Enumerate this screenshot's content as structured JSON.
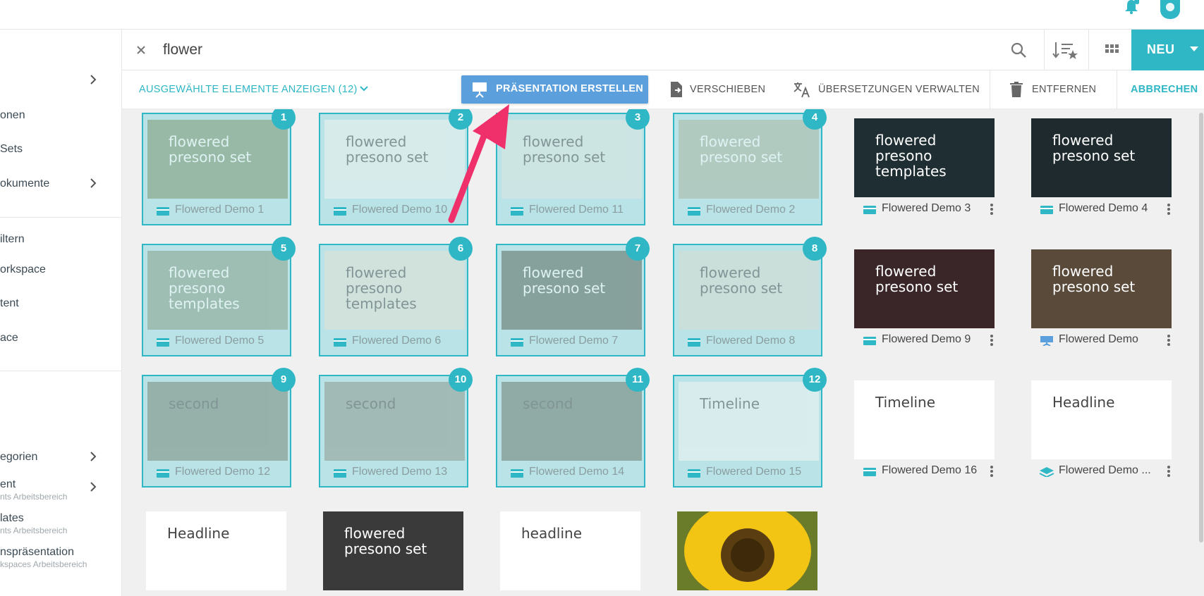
{
  "topbar": {
    "notification_icon": "bell-icon",
    "user_icon": "user-avatar-icon"
  },
  "sidebar": {
    "items": [
      {
        "label": "",
        "has_chevron": true
      },
      {
        "label": "onen"
      },
      {
        "label": "Sets"
      },
      {
        "label": "okumente",
        "has_chevron": true
      },
      {
        "label": "iltern"
      },
      {
        "label": "orkspace"
      },
      {
        "label": "tent"
      },
      {
        "label": "ace"
      },
      {
        "label": "egorien",
        "has_chevron": true
      },
      {
        "label": "ent",
        "sub": "nts Arbeitsbereich",
        "has_chevron": true
      },
      {
        "label": "lates",
        "sub": "nts Arbeitsbereich"
      },
      {
        "label": "nspräsentation",
        "sub": "kspaces Arbeitsbereich"
      }
    ]
  },
  "search": {
    "value": "flower",
    "clear_icon": "close-icon",
    "search_icon": "search-icon",
    "sort_icon": "sort-favorites-icon",
    "grid_icon": "grid-view-icon"
  },
  "new_button": {
    "label": "NEU"
  },
  "actions": {
    "show_selected": "AUSGEWÄHLTE ELEMENTE ANZEIGEN (12)",
    "create_presentation": "PRÄSENTATION ERSTELLEN",
    "move": "VERSCHIEBEN",
    "translations": "ÜBERSETZUNGEN VERWALTEN",
    "remove": "ENTFERNEN",
    "cancel": "ABBRECHEN"
  },
  "colors": {
    "accent": "#2fb7c6",
    "create_button": "#5ba0dd",
    "arrow": "#f0306a",
    "selected_bg": "#b9e3e6"
  },
  "cards": [
    {
      "name": "Flowered Demo 1",
      "badge": "1",
      "selected": true,
      "thumb_text": "flowered presono set",
      "bg": "#7d9770",
      "text_color": "#ffffff",
      "type": "presentation"
    },
    {
      "name": "Flowered Demo 10",
      "badge": "2",
      "selected": true,
      "thumb_text": "flowered presono set",
      "bg": "#eef2ee",
      "text_color": "#555555",
      "type": "presentation"
    },
    {
      "name": "Flowered Demo 11",
      "badge": "3",
      "selected": true,
      "thumb_text": "flowered presono set",
      "bg": "#dde7e2",
      "text_color": "#555555",
      "type": "presentation"
    },
    {
      "name": "Flowered Demo 2",
      "badge": "4",
      "selected": true,
      "thumb_text": "flowered presono set",
      "bg": "#aab7a2",
      "text_color": "#ffffff",
      "type": "presentation"
    },
    {
      "name": "Flowered Demo 3",
      "badge": "",
      "selected": false,
      "thumb_text": "flowered presono templates",
      "bg": "#1e2e33",
      "text_color": "#ffffff",
      "type": "presentation"
    },
    {
      "name": "Flowered Demo 4",
      "badge": "",
      "selected": false,
      "thumb_text": "flowered presono set",
      "bg": "#1f2a2e",
      "text_color": "#ffffff",
      "type": "presentation"
    },
    {
      "name": "Flowered Demo 5",
      "badge": "5",
      "selected": true,
      "thumb_text": "flowered presono templates",
      "bg": "#8aa08a",
      "text_color": "#ffffff",
      "type": "presentation"
    },
    {
      "name": "Flowered Demo 6",
      "badge": "6",
      "selected": true,
      "thumb_text": "flowered presono templates",
      "bg": "#e6e2d6",
      "text_color": "#555555",
      "type": "presentation"
    },
    {
      "name": "Flowered Demo 7",
      "badge": "7",
      "selected": true,
      "thumb_text": "flowered presono set",
      "bg": "#5e6a5e",
      "text_color": "#ffffff",
      "type": "presentation"
    },
    {
      "name": "Flowered Demo 8",
      "badge": "8",
      "selected": true,
      "thumb_text": "flowered presono set",
      "bg": "#d8dcd2",
      "text_color": "#555555",
      "type": "presentation"
    },
    {
      "name": "Flowered Demo 9",
      "badge": "",
      "selected": false,
      "thumb_text": "flowered presono set",
      "bg": "#3a2629",
      "text_color": "#ffffff",
      "type": "presentation"
    },
    {
      "name": "Flowered Demo",
      "badge": "",
      "selected": false,
      "thumb_text": "flowered presono set",
      "bg": "#5a4a3a",
      "text_color": "#ffffff",
      "type": "presenter"
    },
    {
      "name": "Flowered Demo 12",
      "badge": "9",
      "selected": true,
      "thumb_text": "second",
      "bg": "#7a8a7a",
      "text_color": "#555555",
      "type": "presentation"
    },
    {
      "name": "Flowered Demo 13",
      "badge": "10",
      "selected": true,
      "thumb_text": "second",
      "bg": "#8f9a8e",
      "text_color": "#555555",
      "type": "presentation"
    },
    {
      "name": "Flowered Demo 14",
      "badge": "11",
      "selected": true,
      "thumb_text": "second",
      "bg": "#6f7d70",
      "text_color": "#555555",
      "type": "presentation"
    },
    {
      "name": "Flowered Demo 15",
      "badge": "12",
      "selected": true,
      "thumb_text": "Timeline",
      "bg": "#f4f4f4",
      "text_color": "#555555",
      "type": "presentation"
    },
    {
      "name": "Flowered Demo 16",
      "badge": "",
      "selected": false,
      "thumb_text": "Timeline",
      "bg": "#ffffff",
      "text_color": "#444444",
      "type": "presentation"
    },
    {
      "name": "Flowered Demo ...",
      "badge": "",
      "selected": false,
      "thumb_text": "Headline",
      "bg": "#ffffff",
      "text_color": "#444444",
      "type": "layers"
    },
    {
      "name": "",
      "badge": "",
      "selected": false,
      "thumb_text": "Headline",
      "bg": "#ffffff",
      "text_color": "#444444",
      "type": "none"
    },
    {
      "name": "",
      "badge": "",
      "selected": false,
      "thumb_text": "flowered presono set",
      "bg": "#3a3a3a",
      "text_color": "#ffffff",
      "type": "none"
    },
    {
      "name": "",
      "badge": "",
      "selected": false,
      "thumb_text": "headline",
      "bg": "#ffffff",
      "text_color": "#444444",
      "type": "none"
    },
    {
      "name": "",
      "badge": "",
      "selected": false,
      "thumb_text": "",
      "bg": "#e2b815",
      "text_color": "#ffffff",
      "type": "none"
    }
  ]
}
